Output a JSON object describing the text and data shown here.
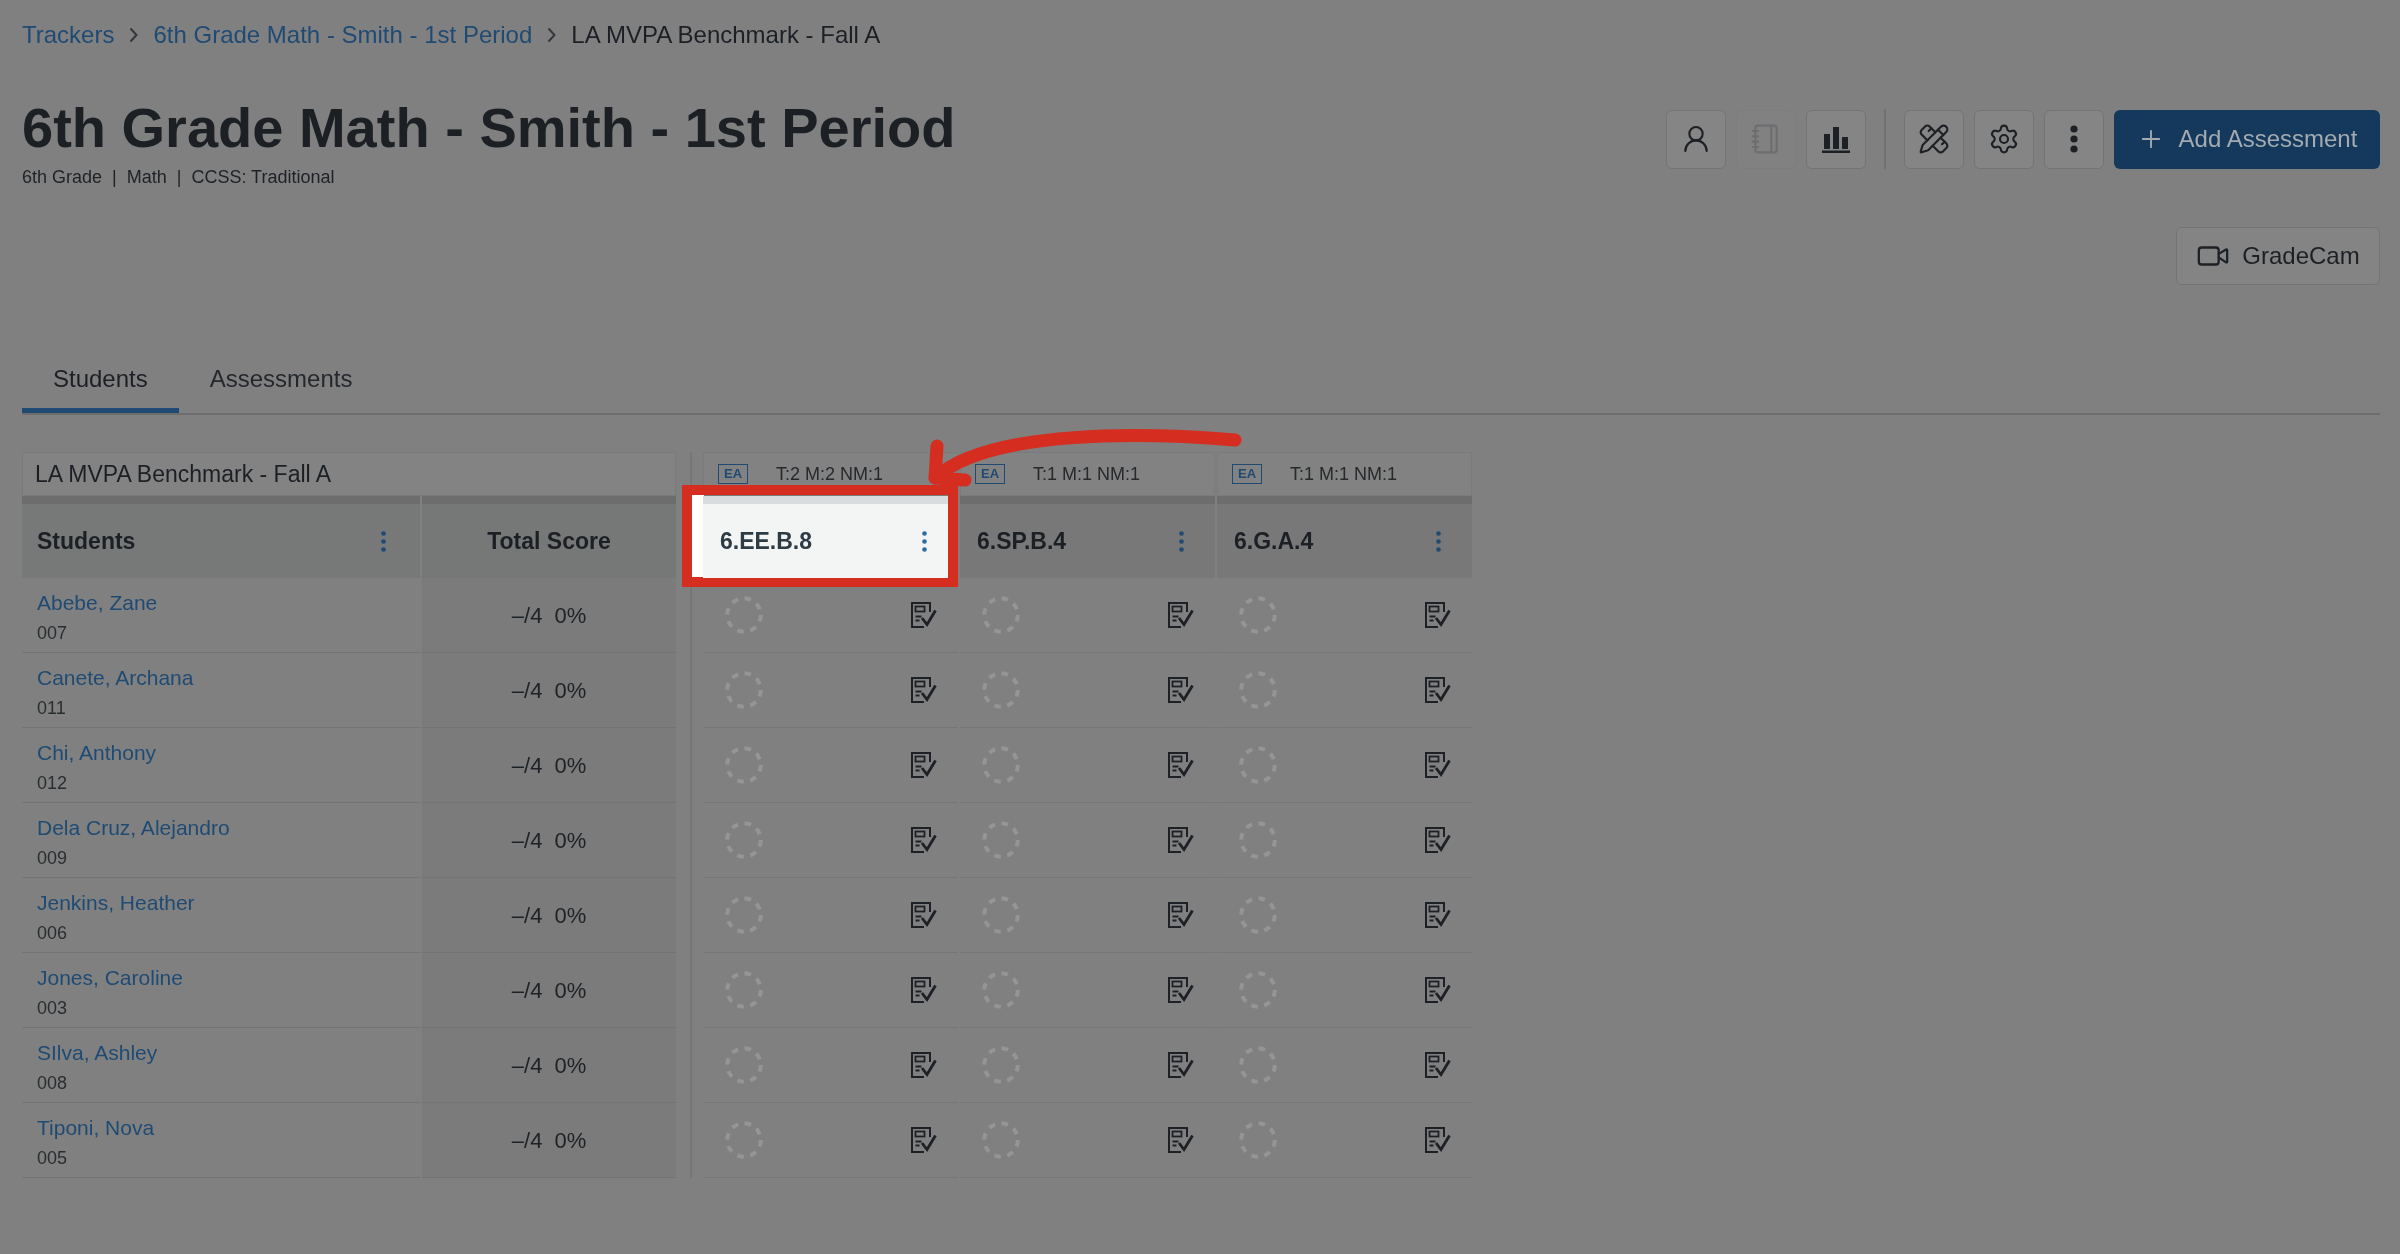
{
  "breadcrumbs": [
    {
      "label": "Trackers",
      "kind": "link"
    },
    {
      "label": "6th Grade Math - Smith - 1st Period",
      "kind": "link"
    },
    {
      "label": "LA MVPA Benchmark - Fall A",
      "kind": "current"
    }
  ],
  "title": "6th Grade Math - Smith - 1st Period",
  "subtitle": "6th Grade  |  Math  |  CCSS: Traditional",
  "toolbar": {
    "groups": [
      [
        {
          "kind": "person",
          "disabled": false
        },
        {
          "kind": "notebook",
          "disabled": true
        },
        {
          "kind": "chart",
          "disabled": false
        }
      ],
      [
        {
          "kind": "tools",
          "disabled": false
        },
        {
          "kind": "settings",
          "disabled": false
        },
        {
          "kind": "more",
          "disabled": false
        }
      ]
    ],
    "primary_button": "Add Assessment"
  },
  "gradecam_button": "GradeCam",
  "tabs": [
    {
      "label": "Students",
      "selected": true
    },
    {
      "label": "Assessments",
      "selected": false
    }
  ],
  "table": {
    "assessment": "LA MVPA Benchmark - Fall A",
    "student_header": "Students",
    "total_header": "Total Score",
    "standards": [
      {
        "badge": "EA",
        "counts": "T:2 M:2 NM:1",
        "label": "6.EE.B.8",
        "highlighted": true
      },
      {
        "badge": "EA",
        "counts": "T:1 M:1 NM:1",
        "label": "6.SP.B.4",
        "highlighted": false
      },
      {
        "badge": "EA",
        "counts": "T:1 M:1 NM:1",
        "label": "6.G.A.4",
        "highlighted": false
      }
    ],
    "rows": [
      {
        "name": "Abebe, Zane",
        "id": "007",
        "score": "–/4",
        "percent": "0%"
      },
      {
        "name": "Canete, Archana",
        "id": "011",
        "score": "–/4",
        "percent": "0%"
      },
      {
        "name": "Chi, Anthony",
        "id": "012",
        "score": "–/4",
        "percent": "0%"
      },
      {
        "name": "Dela Cruz, Alejandro",
        "id": "009",
        "score": "–/4",
        "percent": "0%"
      },
      {
        "name": "Jenkins, Heather",
        "id": "006",
        "score": "–/4",
        "percent": "0%"
      },
      {
        "name": "Jones, Caroline",
        "id": "003",
        "score": "–/4",
        "percent": "0%"
      },
      {
        "name": "SIlva, Ashley",
        "id": "008",
        "score": "–/4",
        "percent": "0%"
      },
      {
        "name": "Tiponi, Nova",
        "id": "005",
        "score": "–/4",
        "percent": "0%"
      }
    ]
  }
}
